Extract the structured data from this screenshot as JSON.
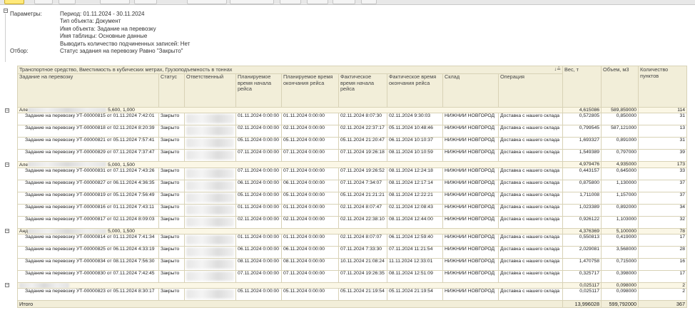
{
  "parameters": {
    "label": "Параметры:",
    "period": "Период: 01.11.2024 - 30.11.2024",
    "object_type": "Тип объекта: Документ",
    "object_name": "Имя объекта: Задание на перевозку",
    "table_name": "Имя таблицы: Основные данные",
    "subordinate": "Выводить количество подчиненных записей: Нет",
    "filter_label": "Отбор:",
    "filter_value": "Статус задания на перевозку Равно \"Закрыто\""
  },
  "report": {
    "group_header": "Транспортное средство, Вместимость в кубических метрах, Грузоподъемность в тоннах",
    "columns": {
      "task": "Задание на перевозку",
      "status": "Статус",
      "responsible": "Ответственный",
      "plan_start": "Планируемое время начала рейса",
      "plan_end": "Планируемое время окончания рейса",
      "fact_start": "Фактическое время начала рейса",
      "fact_end": "Фактическое время окончания рейса",
      "warehouse": "Склад",
      "operation": "Операция",
      "weight": "Вес, т",
      "volume": "Объем, м3",
      "points": "Количество пунктов"
    },
    "sort_icon": "↓≟",
    "groups": [
      {
        "name_prefix": "Але",
        "name_suffix": "5,600, 1,000",
        "weight": "4,615086",
        "volume": "589,859000",
        "points": "114",
        "rows": [
          {
            "task": "Задание на перевозку УТ-00000815 от 01.11.2024 7:42:01",
            "status": "Закрыто",
            "plan_start": "01.11.2024 0:00:00",
            "plan_end": "01.11.2024 0:00:00",
            "fact_start": "02.11.2024 8:07:30",
            "fact_end": "02.11.2024 9:30:03",
            "warehouse": "НИЖНИЙ НОВГОРОД",
            "operation": "Доставка с нашего склада",
            "weight": "0,572805",
            "volume": "0,850000",
            "points": "31"
          },
          {
            "task": "Задание на перевозку УТ-00000818 от 02.11.2024 8:20:39",
            "status": "Закрыто",
            "plan_start": "02.11.2024 0:00:00",
            "plan_end": "02.11.2024 0:00:00",
            "fact_start": "02.11.2024 22:37:17",
            "fact_end": "05.11.2024 10:48:46",
            "warehouse": "НИЖНИЙ НОВГОРОД",
            "operation": "Доставка с нашего склада",
            "weight": "0,799545",
            "volume": "587,121000",
            "points": "13"
          },
          {
            "task": "Задание на перевозку УТ-00000821 от 05.11.2024 7:57:41",
            "status": "Закрыто",
            "plan_start": "05.11.2024 0:00:00",
            "plan_end": "05.11.2024 0:00:00",
            "fact_start": "05.11.2024 21:20:47",
            "fact_end": "06.11.2024 10:10:37",
            "warehouse": "НИЖНИЙ НОВГОРОД",
            "operation": "Доставка с нашего склада",
            "weight": "1,693327",
            "volume": "0,891000",
            "points": "31"
          },
          {
            "task": "Задание на перевозку УТ-00000829 от 07.11.2024 7:37:47",
            "status": "Закрыто",
            "plan_start": "07.11.2024 0:00:00",
            "plan_end": "07.11.2024 0:00:00",
            "fact_start": "07.11.2024 19:26:18",
            "fact_end": "08.11.2024 10:10:59",
            "warehouse": "НИЖНИЙ НОВГОРОД",
            "operation": "Доставка с нашего склада",
            "weight": "1,549389",
            "volume": "0,797000",
            "points": "39"
          }
        ]
      },
      {
        "name_prefix": "Але",
        "name_suffix": "5,000, 1,500",
        "weight": "4,979476",
        "volume": "4,935000",
        "points": "173",
        "rows": [
          {
            "task": "Задание на перевозку УТ-00000831 от 07.11.2024 7:43:26",
            "status": "Закрыто",
            "plan_start": "07.11.2024 0:00:00",
            "plan_end": "07.11.2024 0:00:00",
            "fact_start": "07.11.2024 19:26:52",
            "fact_end": "08.11.2024 12:24:18",
            "warehouse": "НИЖНИЙ НОВГОРОД",
            "operation": "Доставка с нашего склада",
            "weight": "0,443157",
            "volume": "0,645000",
            "points": "33"
          },
          {
            "task": "Задание на перевозку УТ-00000827 от 06.11.2024 4:36:35",
            "status": "Закрыто",
            "plan_start": "06.11.2024 0:00:00",
            "plan_end": "06.11.2024 0:00:00",
            "fact_start": "07.11.2024 7:34:07",
            "fact_end": "08.11.2024 12:17:14",
            "warehouse": "НИЖНИЙ НОВГОРОД",
            "operation": "Доставка с нашего склада",
            "weight": "0,875800",
            "volume": "1,130000",
            "points": "37"
          },
          {
            "task": "Задание на перевозку УТ-00000819 от 05.11.2024 7:56:49",
            "status": "Закрыто",
            "plan_start": "05.11.2024 0:00:00",
            "plan_end": "05.11.2024 0:00:00",
            "fact_start": "05.11.2024 21:21:21",
            "fact_end": "08.11.2024 12:22:21",
            "warehouse": "НИЖНИЙ НОВГОРОД",
            "operation": "Доставка с нашего склада",
            "weight": "1,711008",
            "volume": "1,157000",
            "points": "37"
          },
          {
            "task": "Задание на перевозку УТ-00000816 от 01.11.2024 7:43:11",
            "status": "Закрыто",
            "plan_start": "01.11.2024 0:00:00",
            "plan_end": "01.11.2024 0:00:00",
            "fact_start": "02.11.2024 8:07:47",
            "fact_end": "02.11.2024 12:08:43",
            "warehouse": "НИЖНИЙ НОВГОРОД",
            "operation": "Доставка с нашего склада",
            "weight": "1,023389",
            "volume": "0,892000",
            "points": "34"
          },
          {
            "task": "Задание на перевозку УТ-00000817 от 02.11.2024 8:09:03",
            "status": "Закрыто",
            "plan_start": "02.11.2024 0:00:00",
            "plan_end": "02.11.2024 0:00:00",
            "fact_start": "02.11.2024 22:38:10",
            "fact_end": "08.11.2024 12:44:00",
            "warehouse": "НИЖНИЙ НОВГОРОД",
            "operation": "Доставка с нашего склада",
            "weight": "0,926122",
            "volume": "1,103000",
            "points": "32"
          }
        ]
      },
      {
        "name_prefix": "Анд",
        "name_suffix": "5,000, 1,500",
        "weight": "4,376369",
        "volume": "5,100000",
        "points": "78",
        "rows": [
          {
            "task": "Задание на перевозку УТ-00000814 от 01.11.2024 7:41:34",
            "status": "Закрыто",
            "plan_start": "01.11.2024 0:00:00",
            "plan_end": "01.11.2024 0:00:00",
            "fact_start": "02.11.2024 8:07:07",
            "fact_end": "06.11.2024 12:59:40",
            "warehouse": "НИЖНИЙ НОВГОРОД",
            "operation": "Доставка с нашего склада",
            "weight": "0,550813",
            "volume": "0,419000",
            "points": "17"
          },
          {
            "task": "Задание на перевозку УТ-00000825 от 06.11.2024 4:33:19",
            "status": "Закрыто",
            "plan_start": "06.11.2024 0:00:00",
            "plan_end": "06.11.2024 0:00:00",
            "fact_start": "07.11.2024 7:33:30",
            "fact_end": "07.11.2024 11:21:54",
            "warehouse": "НИЖНИЙ НОВГОРОД",
            "operation": "Доставка с нашего склада",
            "weight": "2,029081",
            "volume": "3,568000",
            "points": "28"
          },
          {
            "task": "Задание на перевозку УТ-00000834 от 08.11.2024 7:56:30",
            "status": "Закрыто",
            "plan_start": "08.11.2024 0:00:00",
            "plan_end": "08.11.2024 0:00:00",
            "fact_start": "10.11.2024 21:08:24",
            "fact_end": "11.11.2024 12:33:01",
            "warehouse": "НИЖНИЙ НОВГОРОД",
            "operation": "Доставка с нашего склада",
            "weight": "1,470758",
            "volume": "0,715000",
            "points": "16"
          },
          {
            "task": "Задание на перевозку УТ-00000830 от 07.11.2024 7:42:45",
            "status": "Закрыто",
            "plan_start": "07.11.2024 0:00:00",
            "plan_end": "07.11.2024 0:00:00",
            "fact_start": "07.11.2024 19:26:35",
            "fact_end": "08.11.2024 12:51:09",
            "warehouse": "НИЖНИЙ НОВГОРОД",
            "operation": "Доставка с нашего склада",
            "weight": "0,325717",
            "volume": "0,398000",
            "points": "17"
          }
        ]
      },
      {
        "name_prefix": "",
        "name_suffix": "",
        "weight": "0,025117",
        "volume": "0,098000",
        "points": "2",
        "rows": [
          {
            "task": "Задание на перевозку УТ-00000823 от 05.11.2024 8:30:17",
            "status": "Закрыто",
            "plan_start": "05.11.2024 0:00:00",
            "plan_end": "05.11.2024 0:00:00",
            "fact_start": "05.11.2024 21:19:54",
            "fact_end": "05.11.2024 21:19:54",
            "warehouse": "НИЖНИЙ НОВГОРОД",
            "operation": "Доставка с нашего склада",
            "weight": "0,025117",
            "volume": "0,098000",
            "points": "2"
          }
        ]
      }
    ],
    "total": {
      "label": "Итого",
      "weight": "13,996028",
      "volume": "599,792000",
      "points": "367"
    }
  },
  "icons": {
    "collapse": "minus-box-icon",
    "sort": "sort-icon"
  }
}
